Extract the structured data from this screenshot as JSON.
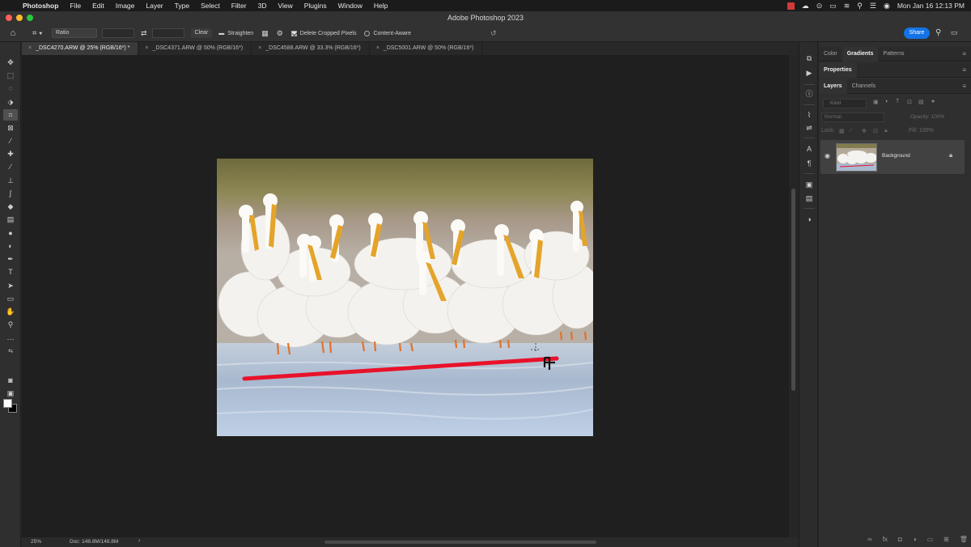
{
  "menubar": {
    "app_name": "Photoshop",
    "items": [
      "File",
      "Edit",
      "Image",
      "Layer",
      "Type",
      "Select",
      "Filter",
      "3D",
      "View",
      "Plugins",
      "Window",
      "Help"
    ],
    "clock": "Mon Jan 16  12:13 PM"
  },
  "window": {
    "title": "Adobe Photoshop 2023"
  },
  "options": {
    "ratio_label": "Ratio",
    "clear_label": "Clear",
    "straighten_label": "Straighten",
    "delete_cropped_label": "Delete Cropped Pixels",
    "content_aware_label": "Content-Aware",
    "share_label": "Share"
  },
  "tabs": [
    {
      "label": "_DSC4270.ARW @ 25% (RGB/16*) *",
      "active": true
    },
    {
      "label": "_DSC4371.ARW @ 50% (RGB/16*)",
      "active": false
    },
    {
      "label": "_DSC4588.ARW @ 33.3% (RGB/16*)",
      "active": false
    },
    {
      "label": "_DSC5001.ARW @ 50% (RGB/16*)",
      "active": false
    }
  ],
  "status": {
    "zoom": "25%",
    "doc": "Doc: 148.8M/148.8M"
  },
  "panels": {
    "top_tabs": [
      "Color",
      "Gradients",
      "Patterns"
    ],
    "properties_label": "Properties",
    "layer_tabs": [
      "Layers",
      "Channels"
    ],
    "filter_kind": "Kind",
    "blend_mode": "Normal",
    "opacity_label": "Opacity:",
    "opacity_value": "100%",
    "lock_label": "Lock:",
    "fill_label": "Fill:",
    "fill_value": "100%",
    "layer_name": "Background"
  },
  "colors": {
    "accent": "#1473e6",
    "straighten_line": "#e8122a",
    "foreground_swatch": "#ffffff",
    "background_swatch": "#000000"
  }
}
